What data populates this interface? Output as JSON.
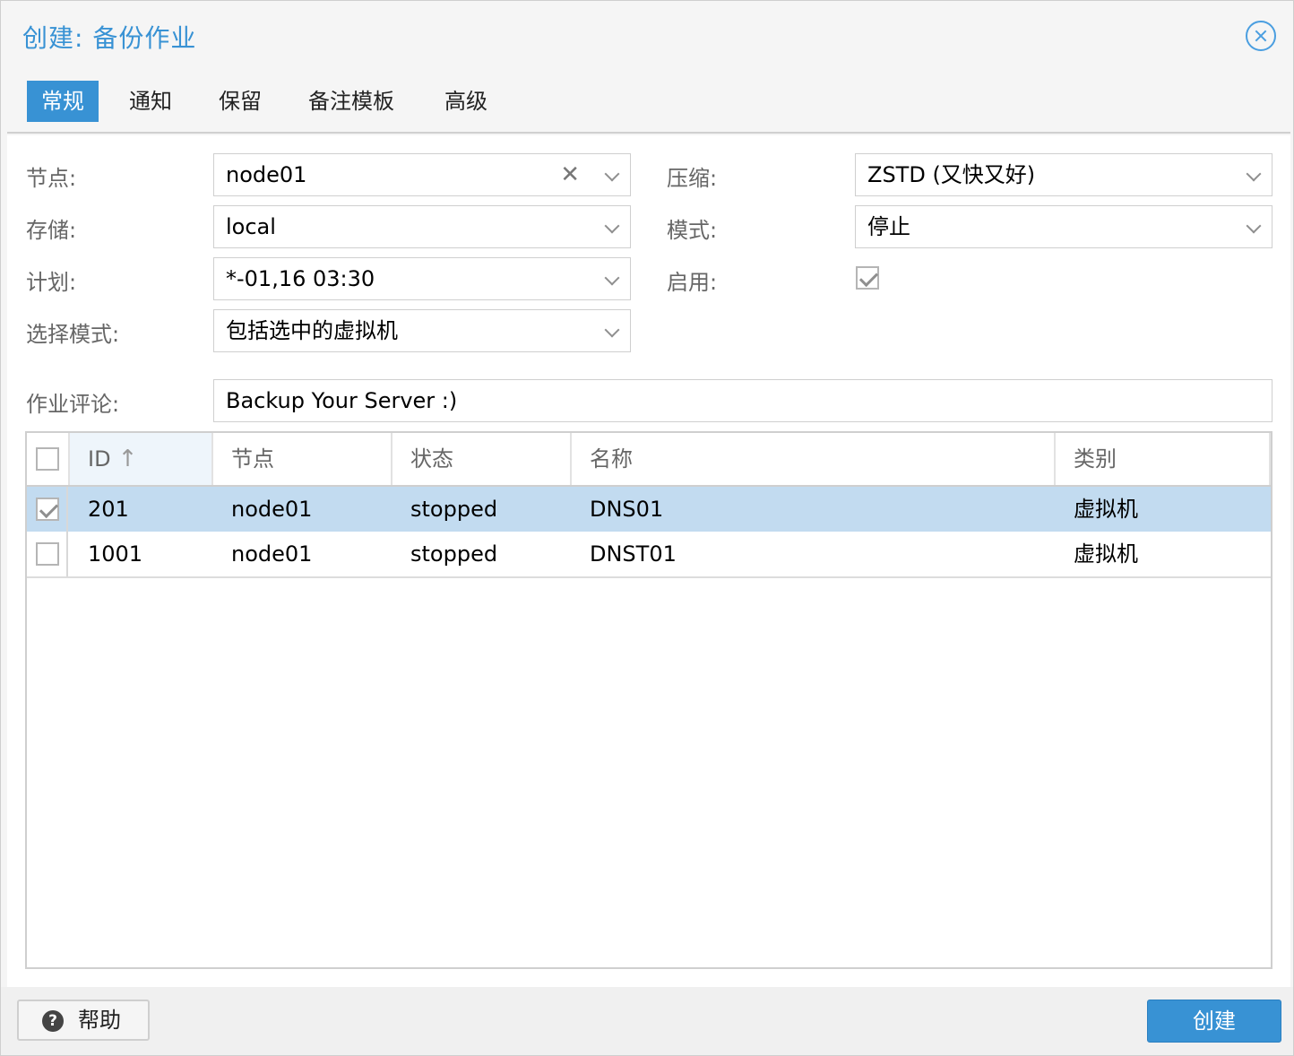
{
  "dialog": {
    "title": "创建: 备份作业",
    "tabs": [
      {
        "label": "常规",
        "active": true
      },
      {
        "label": "通知",
        "active": false
      },
      {
        "label": "保留",
        "active": false
      },
      {
        "label": "备注模板",
        "active": false
      },
      {
        "label": "高级",
        "active": false
      }
    ]
  },
  "form": {
    "node": {
      "label": "节点:",
      "value": "node01"
    },
    "storage": {
      "label": "存储:",
      "value": "local"
    },
    "schedule": {
      "label": "计划:",
      "value": "*-01,16 03:30"
    },
    "selection_mode": {
      "label": "选择模式:",
      "value": "包括选中的虚拟机"
    },
    "compression": {
      "label": "压缩:",
      "value": "ZSTD (又快又好)"
    },
    "mode": {
      "label": "模式:",
      "value": "停止"
    },
    "enabled": {
      "label": "启用:",
      "checked": true
    },
    "comment": {
      "label": "作业评论:",
      "value": "Backup Your Server :)"
    }
  },
  "grid": {
    "columns": [
      "ID",
      "节点",
      "状态",
      "名称",
      "类别"
    ],
    "sort_column": "ID",
    "sort_direction": "ascending",
    "rows": [
      {
        "id": "201",
        "node": "node01",
        "status": "stopped",
        "name": "DNS01",
        "type": "虚拟机",
        "checked": true,
        "selected": true
      },
      {
        "id": "1001",
        "node": "node01",
        "status": "stopped",
        "name": "DNST01",
        "type": "虚拟机",
        "checked": false,
        "selected": false
      }
    ]
  },
  "footer": {
    "help_label": "帮助",
    "create_label": "创建"
  },
  "colors": {
    "accent": "#3892d4",
    "selected_row": "#c2dbf0"
  }
}
